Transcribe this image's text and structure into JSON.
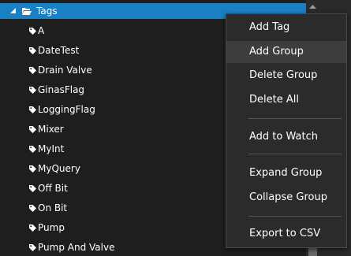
{
  "tree": {
    "root": {
      "label": "Tags",
      "expander_icon": "triangle-down-icon",
      "icon": "folder-open-icon"
    },
    "items": [
      {
        "label": "A"
      },
      {
        "label": "DateTest"
      },
      {
        "label": "Drain Valve"
      },
      {
        "label": "GinasFlag"
      },
      {
        "label": "LoggingFlag"
      },
      {
        "label": "Mixer"
      },
      {
        "label": "MyInt"
      },
      {
        "label": "MyQuery"
      },
      {
        "label": "Off Bit"
      },
      {
        "label": "On Bit"
      },
      {
        "label": "Pump"
      },
      {
        "label": "Pump And Valve"
      }
    ],
    "item_icon": "tag-icon"
  },
  "context_menu": {
    "items": [
      {
        "label": "Add Tag"
      },
      {
        "label": "Add Group",
        "highlighted": true
      },
      {
        "label": "Delete Group"
      },
      {
        "label": "Delete All"
      },
      {
        "label": "Add to Watch"
      },
      {
        "label": "Expand Group"
      },
      {
        "label": "Collapse Group"
      },
      {
        "label": "Export to CSV"
      }
    ]
  },
  "colors": {
    "background": "#1e1e1e",
    "selection": "#1a80c4",
    "menu_background": "#2b2b2b",
    "menu_highlight": "#3d3d3d",
    "text": "#ffffff"
  }
}
